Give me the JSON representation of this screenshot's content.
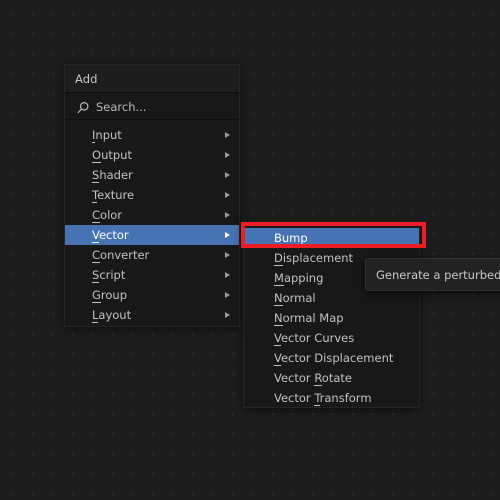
{
  "app": {
    "background_color": "#1d1d1d",
    "accent_color": "#4772b3",
    "annotation_color": "#ee1c25"
  },
  "add_menu": {
    "title": "Add",
    "search": {
      "icon": "search-icon",
      "placeholder": "Search...",
      "value": "Search..."
    },
    "items": [
      {
        "label": "Input",
        "accel": "I",
        "has_submenu": true,
        "selected": false
      },
      {
        "label": "Output",
        "accel": "O",
        "has_submenu": true,
        "selected": false
      },
      {
        "label": "Shader",
        "accel": "S",
        "has_submenu": true,
        "selected": false
      },
      {
        "label": "Texture",
        "accel": "T",
        "has_submenu": true,
        "selected": false
      },
      {
        "label": "Color",
        "accel": "C",
        "has_submenu": true,
        "selected": false
      },
      {
        "label": "Vector",
        "accel": "V",
        "has_submenu": true,
        "selected": true
      },
      {
        "label": "Converter",
        "accel": "C",
        "has_submenu": true,
        "selected": false
      },
      {
        "label": "Script",
        "accel": "S",
        "has_submenu": true,
        "selected": false
      },
      {
        "label": "Group",
        "accel": "G",
        "has_submenu": true,
        "selected": false
      },
      {
        "label": "Layout",
        "accel": "L",
        "has_submenu": true,
        "selected": false
      }
    ]
  },
  "vector_submenu": {
    "items": [
      {
        "label": "Bump",
        "accel": "B",
        "selected": true
      },
      {
        "label": "Displacement",
        "accel": "D",
        "selected": false
      },
      {
        "label": "Mapping",
        "accel": "M",
        "selected": false
      },
      {
        "label": "Normal",
        "accel": "N",
        "selected": false
      },
      {
        "label": "Normal Map",
        "accel": "N",
        "selected": false
      },
      {
        "label": "Vector Curves",
        "accel": "V",
        "selected": false
      },
      {
        "label": "Vector Displacement",
        "accel": "V",
        "selected": false
      },
      {
        "label": "Vector Rotate",
        "accel": "R",
        "selected": false
      },
      {
        "label": "Vector Transform",
        "accel": "T",
        "selected": false
      }
    ]
  },
  "tooltip": {
    "text": "Generate a perturbed norm"
  }
}
